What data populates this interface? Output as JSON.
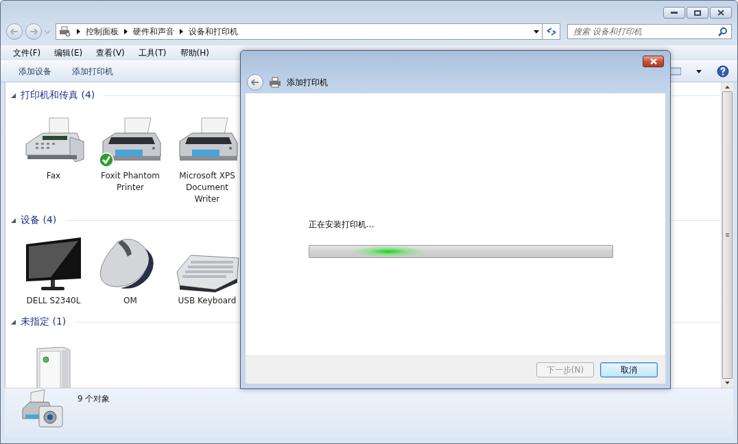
{
  "address_bar": {
    "breadcrumbs": [
      "控制面板",
      "硬件和声音",
      "设备和打印机"
    ]
  },
  "search": {
    "placeholder": "搜索 设备和打印机"
  },
  "menu": [
    "文件(F)",
    "编辑(E)",
    "查看(V)",
    "工具(T)",
    "帮助(H)"
  ],
  "toolbar": {
    "buttons": [
      "添加设备",
      "添加打印机"
    ]
  },
  "groups": [
    {
      "title": "打印机和传真 (4)",
      "expanded": true,
      "items": [
        {
          "name": "Fax",
          "kind": "fax",
          "default": false
        },
        {
          "name": "Foxit Phantom Printer",
          "kind": "printer",
          "default": true
        },
        {
          "name": "Microsoft XPS Document Writer",
          "kind": "printer",
          "default": false
        }
      ]
    },
    {
      "title": "设备 (4)",
      "expanded": true,
      "items": [
        {
          "name": "DELL S2340L",
          "kind": "monitor",
          "default": false
        },
        {
          "name": "OM",
          "kind": "mouse",
          "default": false
        },
        {
          "name": "USB Keyboard",
          "kind": "keyboard",
          "default": false
        }
      ]
    },
    {
      "title": "未指定 (1)",
      "expanded": true,
      "items": [
        {
          "kind": "tower",
          "default": false
        }
      ]
    }
  ],
  "status_bar": {
    "text": "9 个对象"
  },
  "dialog": {
    "title": "添加打印机",
    "message": "正在安装打印机...",
    "progress": {
      "kind": "marquee"
    },
    "buttons": [
      {
        "label": "下一步(N)",
        "disabled": true
      },
      {
        "label": "取消",
        "disabled": false
      }
    ]
  }
}
